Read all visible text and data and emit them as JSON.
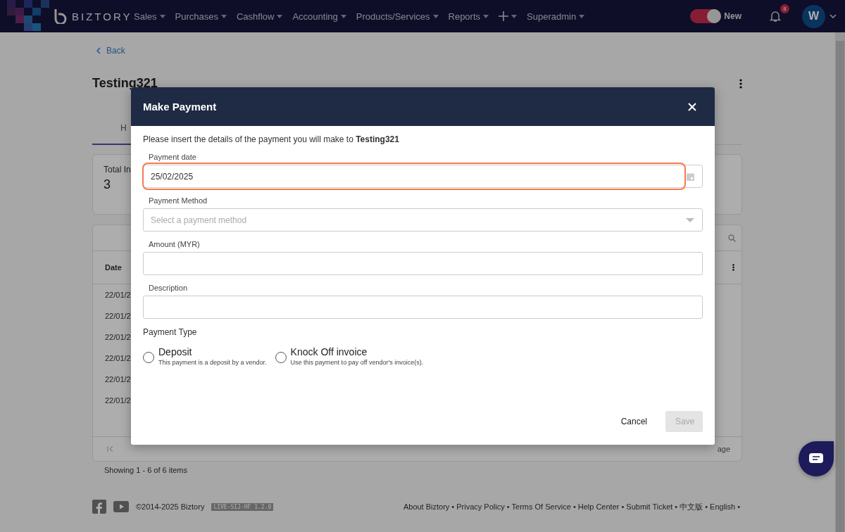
{
  "navbar": {
    "brand": "BIZTORY",
    "menu": [
      {
        "label": "Sales"
      },
      {
        "label": "Purchases"
      },
      {
        "label": "Cashflow"
      },
      {
        "label": "Accounting"
      },
      {
        "label": "Products/Services"
      },
      {
        "label": "Reports"
      }
    ],
    "user_menu": "Superadmin",
    "toggle": {
      "label": "New",
      "on": true
    },
    "notifications": "8",
    "avatar": "W"
  },
  "page": {
    "back": "Back",
    "title": "Testing321",
    "tab": "H",
    "stat": {
      "label": "Total In",
      "value": "3"
    },
    "table": {
      "column": "Date",
      "rows": [
        "22/01/2",
        "22/01/2",
        "22/01/2",
        "22/01/2",
        "22/01/2",
        "22/01/2"
      ],
      "rows_per_page": "age",
      "summary": "Showing 1 - 6 of 6 items"
    }
  },
  "footer": {
    "copyright": "©2014-2025 Biztory",
    "version": "LIVE-SIJ-HF 1.2.0",
    "links": [
      {
        "label": "About Biztory",
        "separator": "•"
      },
      {
        "label": "Privacy Policy",
        "separator": "•"
      },
      {
        "label": "Terms Of Service",
        "separator": "•"
      },
      {
        "label": "Help Center",
        "separator": "•"
      },
      {
        "label": "Submit Ticket",
        "separator": "•"
      },
      {
        "label": "中文版",
        "separator": "•"
      },
      {
        "label": "English",
        "separator": "•"
      }
    ]
  },
  "modal": {
    "title": "Make Payment",
    "intro": "Please insert the details of the payment you will make to **Testing321**",
    "fields": [
      {
        "kind": "date",
        "label": "Payment date",
        "value": "25/02/2025",
        "highlighted": true
      },
      {
        "kind": "select",
        "label": "Payment Method",
        "placeholder": "Select a payment method",
        "highlighted": false
      },
      {
        "kind": "text",
        "label": "Amount (MYR)",
        "highlighted": false
      },
      {
        "kind": "text",
        "label": "Description",
        "highlighted": false
      }
    ],
    "payment_type": {
      "label": "Payment Type",
      "options": [
        {
          "title": "Deposit",
          "hint": "This payment is a deposit by a vendor.",
          "selected": false
        },
        {
          "title": "Knock Off invoice",
          "hint": "Use this payment to pay off vendor's invoice(s).",
          "selected": false
        }
      ]
    },
    "buttons": [
      {
        "label": "Cancel",
        "kind": "text",
        "disabled": false
      },
      {
        "label": "Save",
        "kind": "primary",
        "disabled": true
      }
    ]
  }
}
